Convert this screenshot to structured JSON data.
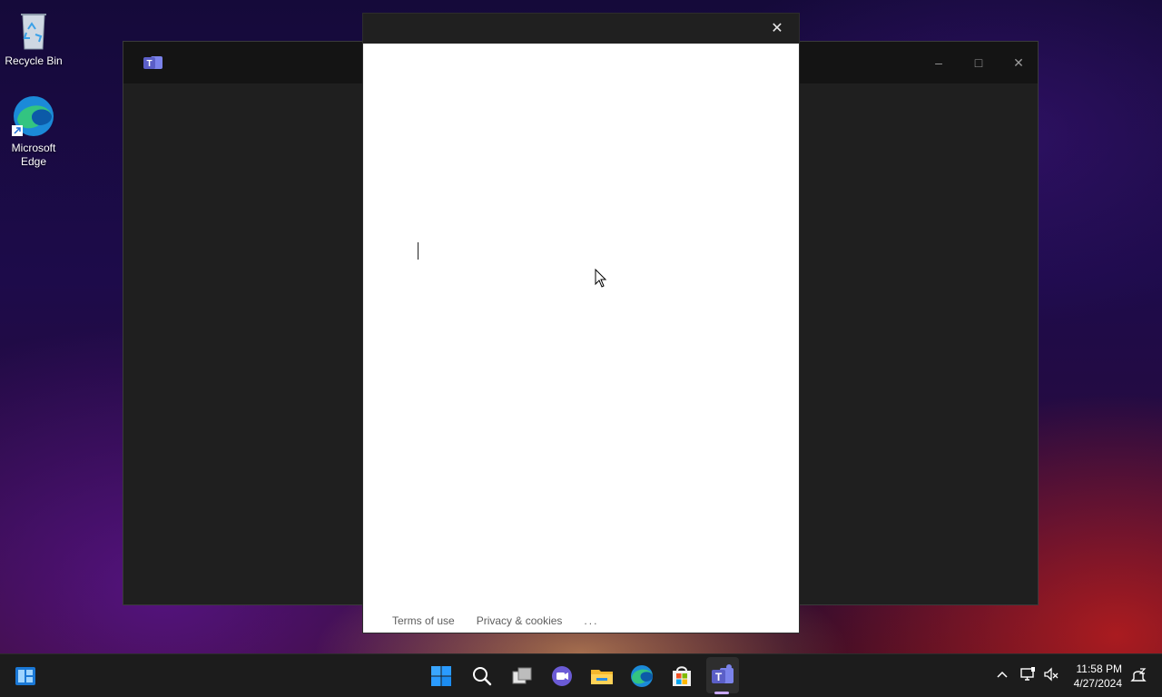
{
  "desktop": {
    "icons": [
      {
        "label": "Recycle Bin",
        "icon": "recycle-bin-icon"
      },
      {
        "label": "Microsoft\nEdge",
        "icon": "edge-icon"
      }
    ]
  },
  "teams_window": {
    "app_icon": "teams-icon",
    "controls": {
      "minimize": "–",
      "maximize": "□",
      "close": "✕"
    }
  },
  "dialog": {
    "close_label": "✕",
    "footer": {
      "terms": "Terms of use",
      "privacy": "Privacy & cookies",
      "more": "..."
    }
  },
  "taskbar": {
    "widgets_icon": "widgets-icon",
    "apps": [
      {
        "name": "start",
        "icon": "windows-start-icon"
      },
      {
        "name": "search",
        "icon": "search-icon"
      },
      {
        "name": "task-view",
        "icon": "task-view-icon"
      },
      {
        "name": "chat",
        "icon": "chat-icon"
      },
      {
        "name": "file-explorer",
        "icon": "folder-icon"
      },
      {
        "name": "edge",
        "icon": "edge-icon"
      },
      {
        "name": "store",
        "icon": "store-icon"
      },
      {
        "name": "teams",
        "icon": "teams-icon",
        "active": true
      }
    ],
    "tray": {
      "chevron": "^",
      "time": "11:58 PM",
      "date": "4/27/2024"
    }
  },
  "colors": {
    "teams_purple": "#5b5fc7",
    "dialog_bg": "#ffffff",
    "taskbar_bg": "#1c1c1c"
  }
}
